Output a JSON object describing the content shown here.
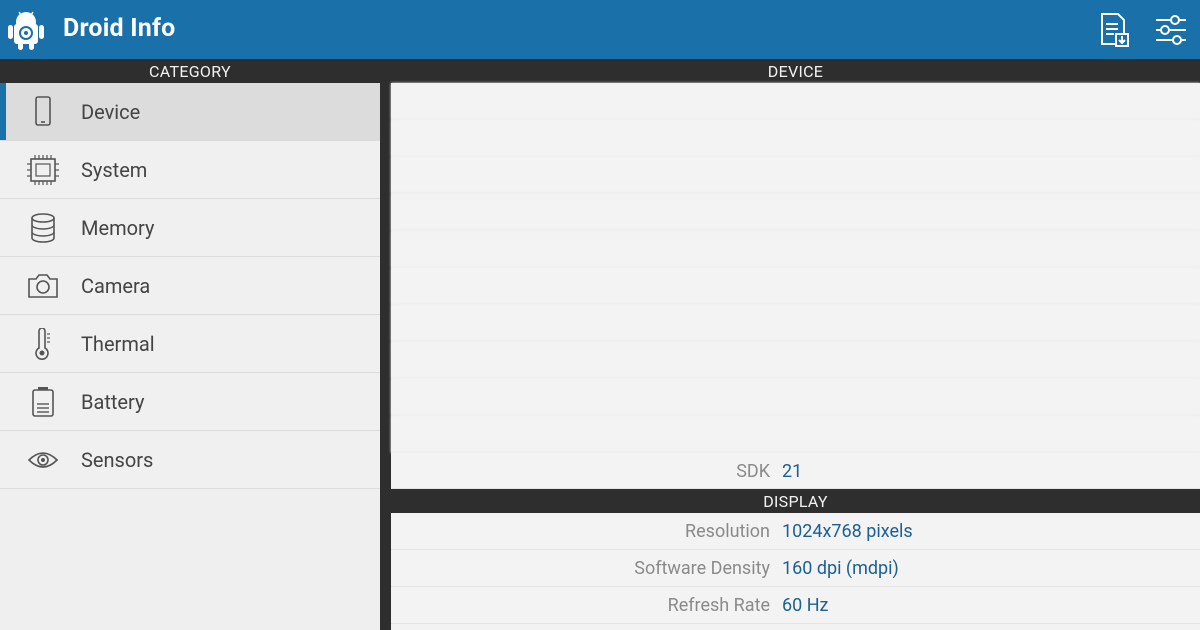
{
  "app": {
    "title": "Droid Info"
  },
  "left": {
    "header": "CATEGORY",
    "items": [
      {
        "label": "Device",
        "icon": "phone-icon",
        "selected": true
      },
      {
        "label": "System",
        "icon": "chip-icon"
      },
      {
        "label": "Memory",
        "icon": "database-icon"
      },
      {
        "label": "Camera",
        "icon": "camera-icon"
      },
      {
        "label": "Thermal",
        "icon": "thermometer-icon"
      },
      {
        "label": "Battery",
        "icon": "battery-icon"
      },
      {
        "label": "Sensors",
        "icon": "eye-icon"
      }
    ]
  },
  "right": {
    "device_header": "DEVICE",
    "device_rows": [
      {
        "key": "",
        "value": ""
      },
      {
        "key": "",
        "value": ""
      },
      {
        "key": "",
        "value": ""
      },
      {
        "key": "",
        "value": ""
      },
      {
        "key": "",
        "value": ""
      },
      {
        "key": "",
        "value": ""
      },
      {
        "key": "",
        "value": ""
      },
      {
        "key": "",
        "value": ""
      },
      {
        "key": "",
        "value": ""
      },
      {
        "key": "",
        "value": ""
      },
      {
        "key": "SDK",
        "value": "21"
      }
    ],
    "display_header": "DISPLAY",
    "display_rows": [
      {
        "key": "Resolution",
        "value": "1024x768 pixels"
      },
      {
        "key": "Software Density",
        "value": "160 dpi (mdpi)"
      },
      {
        "key": "Refresh Rate",
        "value": "60 Hz"
      }
    ]
  },
  "colors": {
    "appbar": "#1a70a8",
    "accent": "#1a70a8",
    "header_bg": "#2e2e2e",
    "value_text": "#1c5f94"
  }
}
